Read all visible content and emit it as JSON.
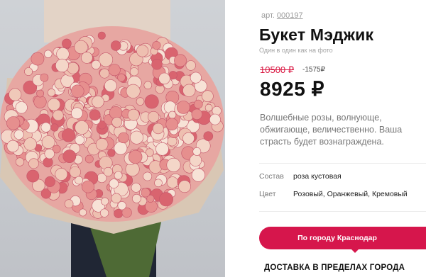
{
  "product": {
    "sku_label": "арт.",
    "sku_code": "000197",
    "title": "Букет Мэджик",
    "subtitle": "Один в один как на фото",
    "old_price": "10500 ₽",
    "discount": "-1575₽",
    "price": "8925 ₽",
    "description": "Волшебные розы, волнующе, обжигающе, величественно. Ваша страсть будет вознаграждена."
  },
  "props": [
    {
      "label": "Состав",
      "value": "роза кустовая"
    },
    {
      "label": "Цвет",
      "value": "Розовый, Оранжевый, Кремовый"
    }
  ],
  "delivery": {
    "city_button": "По городу Краснодар",
    "heading": "ДОСТАВКА В ПРЕДЕЛАХ ГОРОДА"
  },
  "colors": {
    "accent": "#d6164c",
    "old_price": "#d9143f"
  }
}
